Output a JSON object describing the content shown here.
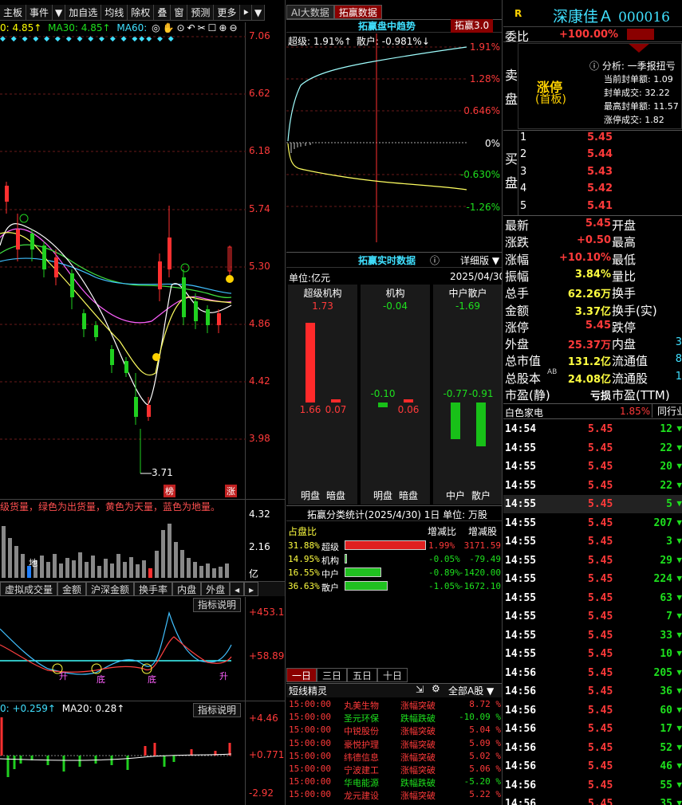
{
  "left": {
    "toolbar": [
      "主板",
      "事件",
      "加自选",
      "均线",
      "除权",
      "叠",
      "窗",
      "预测",
      "更多"
    ],
    "ma_line": {
      "ma5": "0: 4.85↑",
      "ma30": "MA30: 4.85↑",
      "ma60": "MA60:"
    },
    "price_axis": [
      "7.06",
      "6.62",
      "6.18",
      "5.74",
      "5.30",
      "4.86",
      "4.42",
      "3.98"
    ],
    "low_label": "3.71",
    "markers": [
      "榜",
      "涨"
    ],
    "vol_caption": "级货量，绿色为出货量，黄色为天量，蓝色为地量。",
    "vol_axis": [
      "4.32",
      "2.16"
    ],
    "vol_unit": "亿",
    "vol_marker": "地",
    "tabs": [
      "虚拟成交量",
      "金额",
      "沪深金额",
      "换手率",
      "内盘",
      "外盘"
    ],
    "indicator_button": "指标说明",
    "osc_axis": [
      "+453.1",
      "+58.89"
    ],
    "osc_labels": [
      "升",
      "底",
      "底",
      "升"
    ],
    "macd_line": {
      "a": "0: +0.259↑",
      "b": "MA20: 0.28↑"
    },
    "macd_axis": [
      "+4.46",
      "+0.771",
      "-2.92"
    ]
  },
  "mid": {
    "top_tabs": [
      "AI大数据",
      "拓赢数据"
    ],
    "trend_title": "拓赢盘中趋势",
    "trend_version": "拓赢3.0",
    "trend_legend": {
      "super": "超级: 1.91%↑",
      "retail": "散户: -0.981%↓"
    },
    "trend_axis": [
      "1.91%",
      "1.28%",
      "0.646%",
      "0%",
      "-0.630%",
      "-1.26%"
    ],
    "realtime_title": "拓赢实时数据",
    "realtime_detail": "详细版",
    "unit": "单位:亿元",
    "date": "2025/04/30",
    "groups": [
      {
        "name": "超级机构",
        "total": "1.73",
        "bars": [
          {
            "label": "明盘",
            "value": "1.66",
            "v": 1.66
          },
          {
            "label": "暗盘",
            "value": "0.07",
            "v": 0.07
          }
        ]
      },
      {
        "name": "机构",
        "total": "-0.04",
        "bars": [
          {
            "label": "明盘",
            "value": "-0.10",
            "v": -0.1
          },
          {
            "label": "暗盘",
            "value": "0.06",
            "v": 0.06
          }
        ]
      },
      {
        "name": "中户散户",
        "total": "-1.69",
        "bars": [
          {
            "label": "中户",
            "value": "-0.77",
            "v": -0.77
          },
          {
            "label": "散户",
            "value": "-0.91",
            "v": -0.91
          }
        ]
      }
    ],
    "stats_title": "拓赢分类统计(2025/4/30) 1日  单位: 万股",
    "stats_header": [
      "占盘比",
      "增减比",
      "增减股"
    ],
    "stats_rows": [
      {
        "pct": "31.88%",
        "name": "超级",
        "bar": 1.0,
        "color": "#e02020",
        "chg": "1.99%",
        "shares": "3171.59"
      },
      {
        "pct": "14.95%",
        "name": "机构",
        "bar": 0.02,
        "color": "#20c020",
        "chg": "-0.05%",
        "shares": "-79.49"
      },
      {
        "pct": "16.55%",
        "name": "中户",
        "bar": 0.45,
        "color": "#20c020",
        "chg": "-0.89%",
        "shares": "-1420.00"
      },
      {
        "pct": "36.63%",
        "name": "散户",
        "bar": 0.53,
        "color": "#20c020",
        "chg": "-1.05%",
        "shares": "-1672.10"
      }
    ],
    "period_tabs": [
      "一日",
      "三日",
      "五日",
      "十日"
    ],
    "sprite_title": "短线精灵",
    "sprite_filter": "全部A股",
    "sprites": [
      {
        "time": "15:00:00",
        "name": "丸美生物",
        "event": "涨幅突破",
        "val": "8.72 %",
        "up": true
      },
      {
        "time": "15:00:00",
        "name": "圣元环保",
        "event": "跌幅跌破",
        "val": "-10.09 %",
        "up": false
      },
      {
        "time": "15:00:00",
        "name": "中锐股份",
        "event": "涨幅突破",
        "val": "5.04 %",
        "up": true
      },
      {
        "time": "15:00:00",
        "name": "豪悦护理",
        "event": "涨幅突破",
        "val": "5.09 %",
        "up": true
      },
      {
        "time": "15:00:00",
        "name": "纬德信息",
        "event": "涨幅突破",
        "val": "5.02 %",
        "up": true
      },
      {
        "time": "15:00:00",
        "name": "宁波建工",
        "event": "涨幅突破",
        "val": "5.06 %",
        "up": true
      },
      {
        "time": "15:00:00",
        "name": "华电能源",
        "event": "跌幅跌破",
        "val": "-5.20 %",
        "up": false
      },
      {
        "time": "15:00:00",
        "name": "龙元建设",
        "event": "涨幅突破",
        "val": "5.22 %",
        "up": true
      }
    ]
  },
  "right": {
    "r_badge": "R",
    "stock_name": "深康佳Ａ",
    "stock_code": "000016",
    "weibi_label": "委比",
    "weibi_value": "+100.00%",
    "sell_label": "卖盘",
    "limit_text": "涨停",
    "limit_sub": "(首板)",
    "analysis": "分析: 一季报扭亏",
    "info_lines": [
      "当前封单额: 1.09",
      "封单成交: 32.22",
      "最高封单额: 11.57",
      "涨停成交: 1.82"
    ],
    "buy_label": "买盘",
    "buy_rows": [
      {
        "n": "1",
        "p": "5.45"
      },
      {
        "n": "2",
        "p": "5.44"
      },
      {
        "n": "3",
        "p": "5.43"
      },
      {
        "n": "4",
        "p": "5.42"
      },
      {
        "n": "5",
        "p": "5.41"
      }
    ],
    "stats": [
      {
        "l": "最新",
        "v": "5.45",
        "vc": "red",
        "l2": "开盘"
      },
      {
        "l": "涨跌",
        "v": "+0.50",
        "vc": "red",
        "l2": "最高"
      },
      {
        "l": "涨幅",
        "v": "+10.10%",
        "vc": "red",
        "l2": "最低"
      },
      {
        "l": "振幅",
        "v": "3.84%",
        "vc": "yellow",
        "l2": "量比"
      },
      {
        "l": "总手",
        "v": "62.26万",
        "vc": "yellow",
        "l2": "换手"
      },
      {
        "l": "金额",
        "v": "3.37亿",
        "vc": "yellow",
        "l2": "换手(实)"
      },
      {
        "l": "涨停",
        "v": "5.45",
        "vc": "red",
        "l2": "跌停"
      },
      {
        "l": "外盘",
        "v": "25.37万",
        "vc": "red",
        "l2": "内盘"
      },
      {
        "l": "总市值",
        "v": "131.2亿",
        "vc": "yellow",
        "l2": "流通值"
      },
      {
        "l": "总股本",
        "v": "24.08亿",
        "vc": "yellow",
        "l2": "流通股"
      },
      {
        "l": "市盈(静)",
        "v": "亏损",
        "vc": "white",
        "l2": "市盈(TTM)"
      }
    ],
    "stats_partial": [
      "",
      "",
      "",
      "",
      "",
      "",
      "",
      "3",
      "8",
      "1",
      ""
    ],
    "sup_ab": "AB",
    "sector": "白色家电",
    "sector_pct": "1.85%",
    "sector_more": "同行业",
    "trades": [
      {
        "t": "14:54",
        "p": "5.45",
        "v": "12"
      },
      {
        "t": "14:55",
        "p": "5.45",
        "v": "22"
      },
      {
        "t": "14:55",
        "p": "5.45",
        "v": "20"
      },
      {
        "t": "14:55",
        "p": "5.45",
        "v": "22"
      },
      {
        "t": "14:55",
        "p": "5.45",
        "v": "5"
      },
      {
        "t": "14:55",
        "p": "5.45",
        "v": "207"
      },
      {
        "t": "14:55",
        "p": "5.45",
        "v": "3"
      },
      {
        "t": "14:55",
        "p": "5.45",
        "v": "29"
      },
      {
        "t": "14:55",
        "p": "5.45",
        "v": "224"
      },
      {
        "t": "14:55",
        "p": "5.45",
        "v": "63"
      },
      {
        "t": "14:55",
        "p": "5.45",
        "v": "7"
      },
      {
        "t": "14:55",
        "p": "5.45",
        "v": "33"
      },
      {
        "t": "14:55",
        "p": "5.45",
        "v": "10"
      },
      {
        "t": "14:56",
        "p": "5.45",
        "v": "205"
      },
      {
        "t": "14:56",
        "p": "5.45",
        "v": "36"
      },
      {
        "t": "14:56",
        "p": "5.45",
        "v": "60"
      },
      {
        "t": "14:56",
        "p": "5.45",
        "v": "17"
      },
      {
        "t": "14:56",
        "p": "5.45",
        "v": "52"
      },
      {
        "t": "14:56",
        "p": "5.45",
        "v": "46"
      },
      {
        "t": "14:56",
        "p": "5.45",
        "v": "55"
      },
      {
        "t": "14:56",
        "p": "5.45",
        "v": "35"
      }
    ]
  }
}
